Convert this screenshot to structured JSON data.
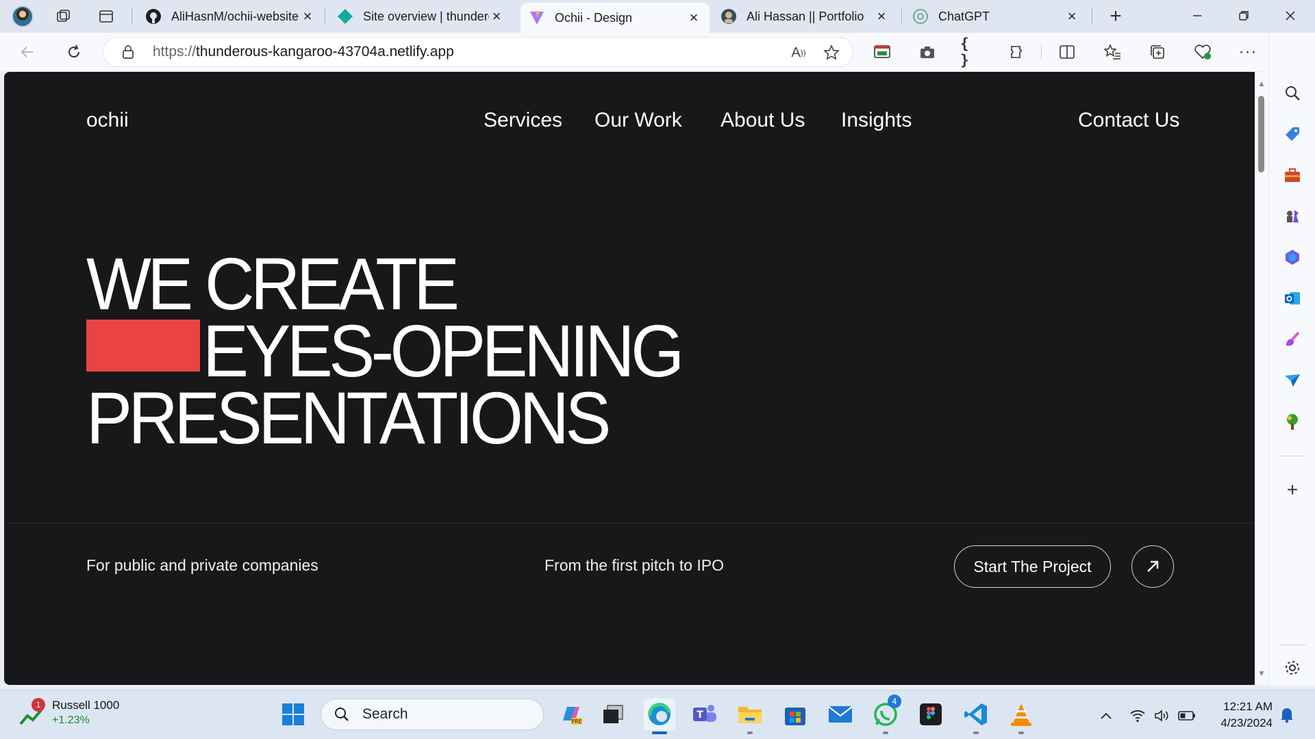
{
  "browser": {
    "tabs": [
      {
        "title": "AliHasnM/ochii-website",
        "favicon": "github-icon",
        "active": false
      },
      {
        "title": "Site overview | thunderous-kangaroo",
        "favicon": "netlify-icon",
        "active": false
      },
      {
        "title": "Ochii - Design",
        "favicon": "vite-icon",
        "active": true
      },
      {
        "title": "Ali Hassan || Portfolio",
        "favicon": "avatar-icon",
        "active": false
      },
      {
        "title": "ChatGPT",
        "favicon": "chatgpt-icon",
        "active": false
      }
    ],
    "new_tab_label": "+",
    "url_protocol": "https://",
    "url_host": "thunderous-kangaroo-43704a.netlify.app"
  },
  "site": {
    "logo": "ochii",
    "nav": [
      "Services",
      "Our Work",
      "About Us",
      "Insights"
    ],
    "contact": "Contact Us",
    "hero": [
      "WE CREATE",
      "EYES-OPENING",
      "PRESENTATIONS"
    ],
    "accent_color": "#e94343",
    "sub_left": "For public and private companies",
    "sub_middle": "From the first pitch to IPO",
    "cta": "Start The Project"
  },
  "taskbar": {
    "widget_name": "Russell 1000",
    "widget_value": "+1.23%",
    "widget_badge": "1",
    "search_label": "Search",
    "whatsapp_badge": "4",
    "time": "12:21 AM",
    "date": "4/23/2024"
  }
}
